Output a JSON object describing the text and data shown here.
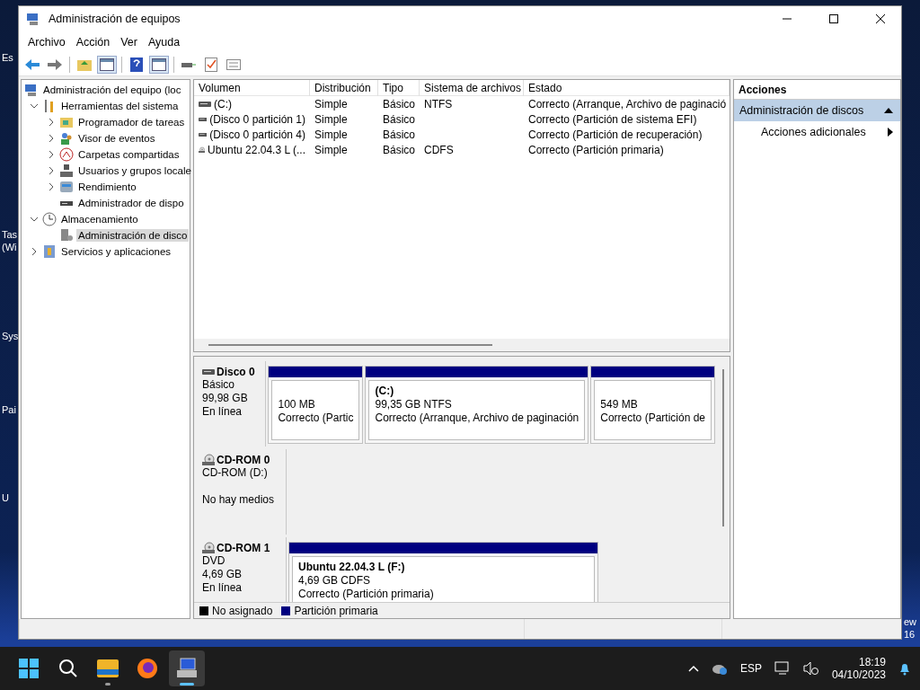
{
  "desktop": {
    "left_labels": [
      "Es",
      "Tas",
      "(Wi",
      "Sys",
      "Pai",
      "U"
    ],
    "right_labels": [
      "ew",
      "16"
    ]
  },
  "window": {
    "title": "Administración de equipos"
  },
  "menu": [
    "Archivo",
    "Acción",
    "Ver",
    "Ayuda"
  ],
  "tree": [
    {
      "label": "Administración del equipo (loc",
      "selected": false,
      "children": [
        {
          "label": "Herramientas del sistema",
          "expanded": true,
          "selected": false,
          "children": [
            {
              "label": "Programador de tareas",
              "expanded": false,
              "selected": false
            },
            {
              "label": "Visor de eventos",
              "expanded": false,
              "selected": false
            },
            {
              "label": "Carpetas compartidas",
              "expanded": false,
              "selected": false
            },
            {
              "label": "Usuarios y grupos locale",
              "expanded": false,
              "selected": false
            },
            {
              "label": "Rendimiento",
              "expanded": false,
              "selected": false
            },
            {
              "label": "Administrador de dispo",
              "selected": false
            }
          ]
        },
        {
          "label": "Almacenamiento",
          "expanded": true,
          "selected": false,
          "children": [
            {
              "label": "Administración de disco",
              "selected": true
            }
          ]
        },
        {
          "label": "Servicios y aplicaciones",
          "expanded": false,
          "selected": false
        }
      ]
    }
  ],
  "volumes": {
    "columns": [
      "Volumen",
      "Distribución",
      "Tipo",
      "Sistema de archivos",
      "Estado"
    ],
    "rows": [
      {
        "kind": "disk",
        "volume": " (C:)",
        "layout": "Simple",
        "type": "Básico",
        "filesystem": "NTFS",
        "status": "Correcto (Arranque, Archivo de paginació"
      },
      {
        "kind": "disk",
        "volume": "(Disco 0 partición 1)",
        "layout": "Simple",
        "type": "Básico",
        "status": "Correcto (Partición de sistema EFI)"
      },
      {
        "kind": "disk",
        "volume": "(Disco 0 partición 4)",
        "layout": "Simple",
        "type": "Básico",
        "status": "Correcto (Partición de recuperación)"
      },
      {
        "kind": "cdrom",
        "volume": "Ubuntu 22.04.3 L (...",
        "layout": "Simple",
        "type": "Básico",
        "filesystem": "CDFS",
        "status": "Correcto (Partición primaria)"
      }
    ]
  },
  "disks": [
    {
      "kind": "disk",
      "name": "Disco 0",
      "type": "Básico",
      "size": "99,98 GB",
      "status": "En línea",
      "partitions": [
        {
          "size": "100 MB",
          "status": "Correcto (Partic"
        },
        {
          "title": " (C:)",
          "size": "99,35 GB NTFS",
          "status": "Correcto (Arranque, Archivo de paginación"
        },
        {
          "size": "549 MB",
          "status": "Correcto (Partición de"
        }
      ]
    },
    {
      "kind": "cdrom",
      "name": "CD-ROM 0",
      "type": "CD-ROM (D:)",
      "status": "No hay medios"
    },
    {
      "kind": "cdrom",
      "name": "CD-ROM 1",
      "type": "DVD",
      "size": "4,69 GB",
      "status": "En línea",
      "partitions": [
        {
          "title": "Ubuntu 22.04.3 L  (F:)",
          "size": "4,69 GB CDFS",
          "status": "Correcto (Partición primaria)"
        }
      ]
    }
  ],
  "legend": [
    {
      "label": "No asignado",
      "color": "#000000"
    },
    {
      "label": "Partición primaria",
      "color": "#000080"
    }
  ],
  "actions": {
    "header": "Acciones",
    "items": [
      {
        "kind": "section",
        "label": "Administración de discos",
        "expanded": true
      },
      {
        "kind": "item",
        "label": "Acciones adicionales"
      }
    ]
  },
  "taskbar": {
    "apps": [
      {
        "kind": "start",
        "active": false
      },
      {
        "kind": "search",
        "active": false
      },
      {
        "kind": "folder",
        "active": false
      },
      {
        "kind": "browser",
        "active": false
      },
      {
        "kind": "computer",
        "active": true
      }
    ],
    "language": "ESP",
    "time": "18:19",
    "date": "04/10/2023"
  }
}
